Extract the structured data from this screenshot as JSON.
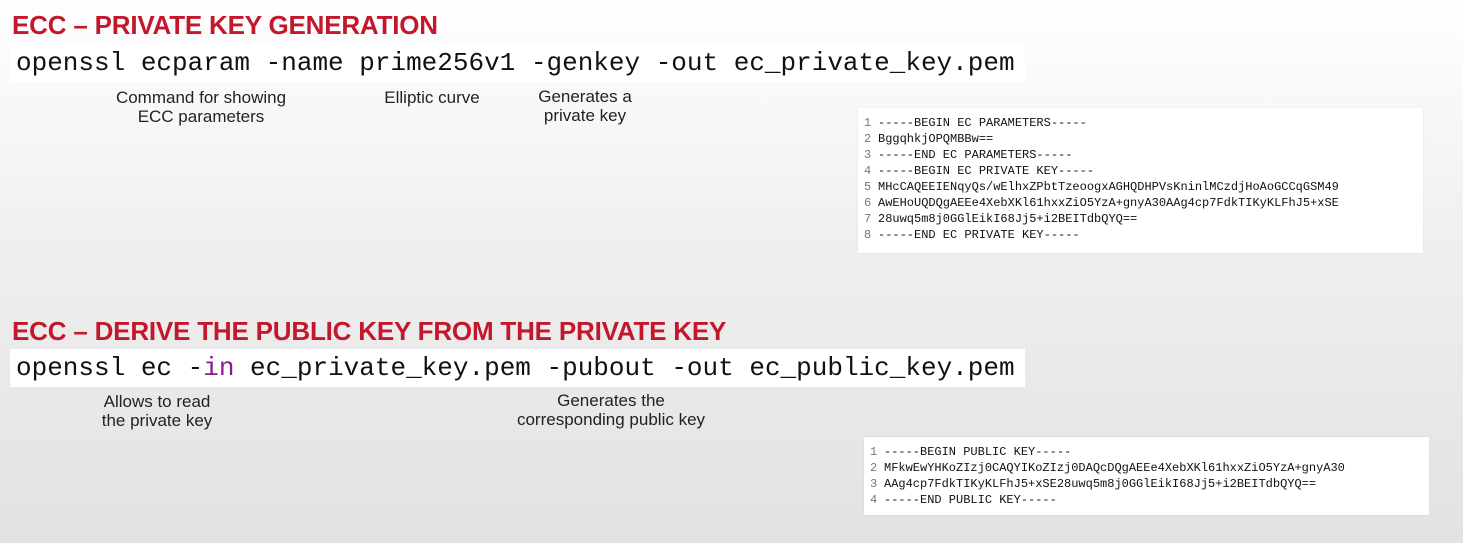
{
  "section1": {
    "title": "ECC – PRIVATE KEY GENERATION",
    "command": {
      "pre": "openssl ecparam -name prime256v1 -genkey -out ec_private_key.pem"
    },
    "annotations": [
      {
        "line1": "Command for showing",
        "line2": "ECC parameters"
      },
      {
        "line1": "Elliptic curve"
      },
      {
        "line1": "Generates a",
        "line2": "private key"
      }
    ],
    "output": [
      {
        "n": "1",
        "text": "-----BEGIN EC PARAMETERS-----"
      },
      {
        "n": "2",
        "text": "BggqhkjOPQMBBw=="
      },
      {
        "n": "3",
        "text": "-----END EC PARAMETERS-----"
      },
      {
        "n": "4",
        "text": "-----BEGIN EC PRIVATE KEY-----"
      },
      {
        "n": "5",
        "text": "MHcCAQEEIENqyQs/wElhxZPbtTzeoogxAGHQDHPVsKninlMCzdjHoAoGCCqGSM49"
      },
      {
        "n": "6",
        "text": "AwEHoUQDQgAEEe4XebXKl61hxxZiO5YzA+gnyA30AAg4cp7FdkTIKyKLFhJ5+xSE"
      },
      {
        "n": "7",
        "text": "28uwq5m8j0GGlEikI68Jj5+i2BEITdbQYQ=="
      },
      {
        "n": "8",
        "text": "-----END EC PRIVATE KEY-----"
      }
    ]
  },
  "section2": {
    "title": "ECC – DERIVE THE PUBLIC KEY FROM THE PRIVATE KEY",
    "command": {
      "pre": "openssl ec -",
      "keyword": "in",
      "post": " ec_private_key.pem -pubout -out ec_public_key.pem"
    },
    "annotations": [
      {
        "line1": "Allows to read",
        "line2": "the private key"
      },
      {
        "line1": "Generates the",
        "line2": "corresponding public key"
      }
    ],
    "output": [
      {
        "n": "1",
        "text": "-----BEGIN PUBLIC KEY-----"
      },
      {
        "n": "2",
        "text": "MFkwEwYHKoZIzj0CAQYIKoZIzj0DAQcDQgAEEe4XebXKl61hxxZiO5YzA+gnyA30"
      },
      {
        "n": "3",
        "text": "AAg4cp7FdkTIKyKLFhJ5+xSE28uwq5m8j0GGlEikI68Jj5+i2BEITdbQYQ=="
      },
      {
        "n": "4",
        "text": "-----END PUBLIC KEY-----"
      }
    ]
  }
}
